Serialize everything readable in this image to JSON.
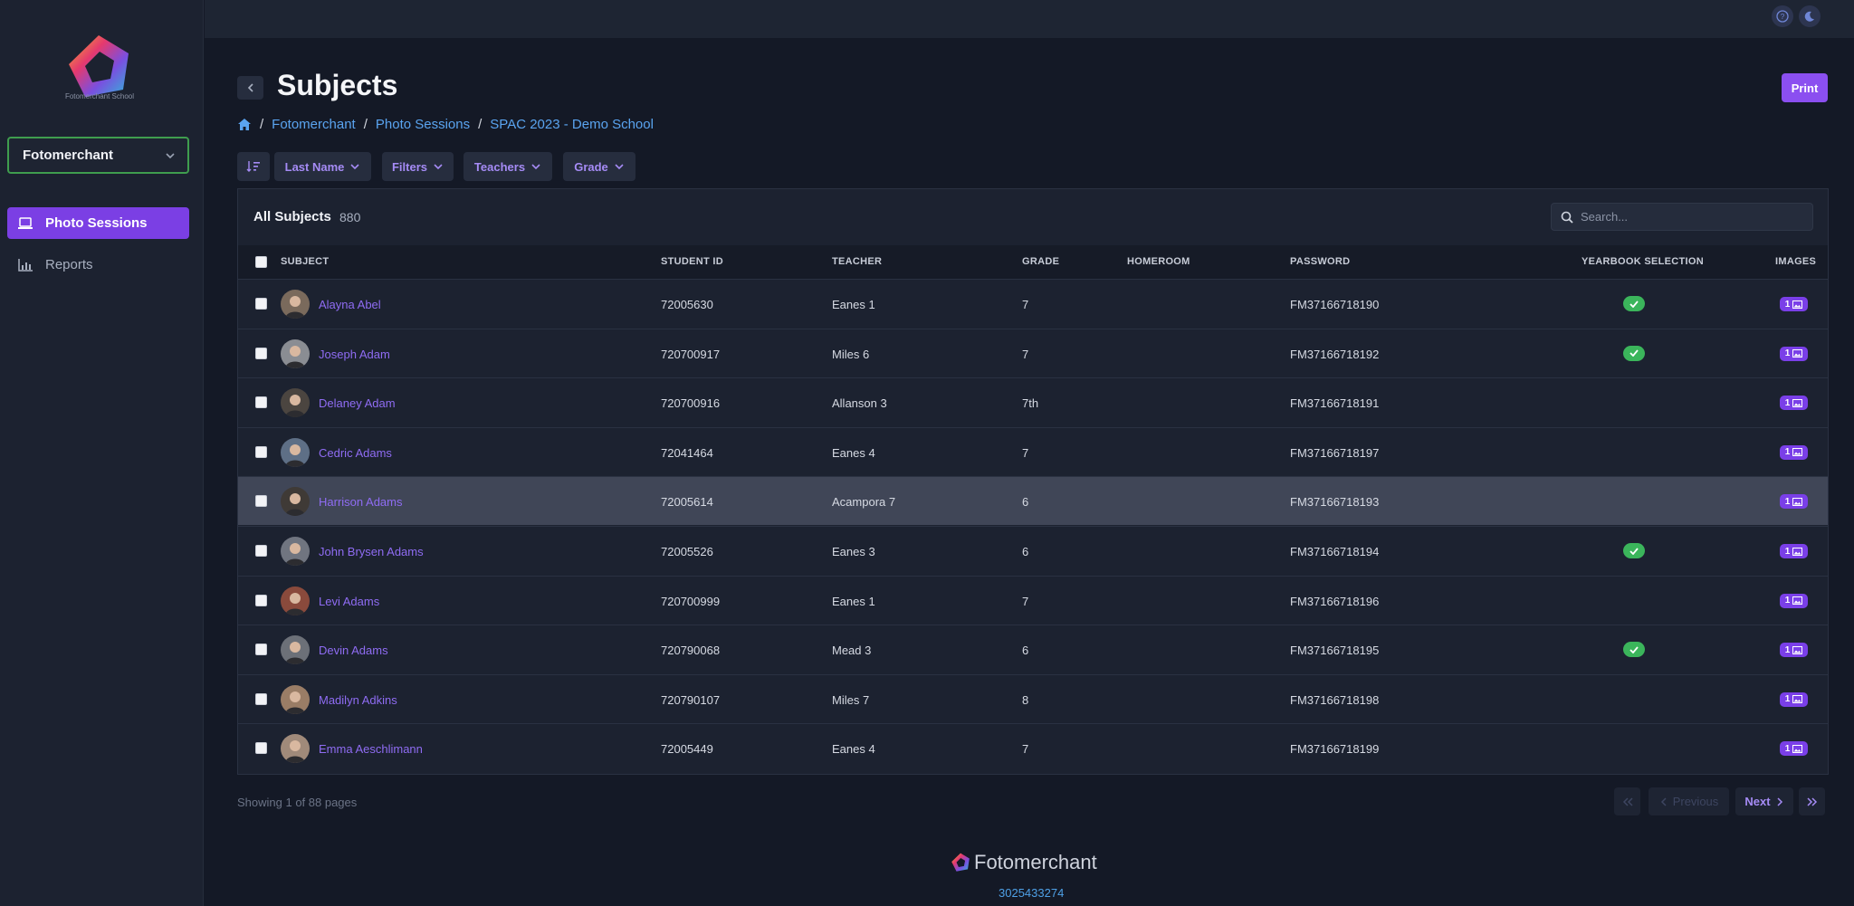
{
  "app": {
    "logo_text": "Fotomerchant School",
    "org_selector": "Fotomerchant",
    "nav": [
      {
        "label": "Photo Sessions",
        "icon": "laptop-icon",
        "active": true
      },
      {
        "label": "Reports",
        "icon": "bar-chart-icon",
        "active": false
      }
    ]
  },
  "header": {
    "title": "Subjects",
    "print_label": "Print",
    "breadcrumb": [
      "Fotomerchant",
      "Photo Sessions",
      "SPAC 2023 - Demo School"
    ]
  },
  "filters": {
    "sort_label": "Last Name",
    "filters_label": "Filters",
    "teachers_label": "Teachers",
    "grade_label": "Grade"
  },
  "table": {
    "title": "All Subjects",
    "count": "880",
    "search_placeholder": "Search...",
    "columns": {
      "subject": "SUBJECT",
      "student_id": "STUDENT ID",
      "teacher": "TEACHER",
      "grade": "GRADE",
      "homeroom": "HOMEROOM",
      "password": "PASSWORD",
      "yearbook": "YEARBOOK SELECTION",
      "images": "IMAGES"
    },
    "rows": [
      {
        "name": "Alayna Abel",
        "student_id": "72005630",
        "teacher": "Eanes 1",
        "grade": "7",
        "homeroom": "",
        "password": "FM37166718190",
        "yearbook": true,
        "images": "1"
      },
      {
        "name": "Joseph Adam",
        "student_id": "720700917",
        "teacher": "Miles 6",
        "grade": "7",
        "homeroom": "",
        "password": "FM37166718192",
        "yearbook": true,
        "images": "1"
      },
      {
        "name": "Delaney Adam",
        "student_id": "720700916",
        "teacher": "Allanson 3",
        "grade": "7th",
        "homeroom": "",
        "password": "FM37166718191",
        "yearbook": false,
        "images": "1"
      },
      {
        "name": "Cedric Adams",
        "student_id": "72041464",
        "teacher": "Eanes 4",
        "grade": "7",
        "homeroom": "",
        "password": "FM37166718197",
        "yearbook": false,
        "images": "1"
      },
      {
        "name": "Harrison Adams",
        "student_id": "72005614",
        "teacher": "Acampora 7",
        "grade": "6",
        "homeroom": "",
        "password": "FM37166718193",
        "yearbook": false,
        "images": "1",
        "hover": true
      },
      {
        "name": "John Brysen Adams",
        "student_id": "72005526",
        "teacher": "Eanes 3",
        "grade": "6",
        "homeroom": "",
        "password": "FM37166718194",
        "yearbook": true,
        "images": "1"
      },
      {
        "name": "Levi Adams",
        "student_id": "720700999",
        "teacher": "Eanes 1",
        "grade": "7",
        "homeroom": "",
        "password": "FM37166718196",
        "yearbook": false,
        "images": "1"
      },
      {
        "name": "Devin Adams",
        "student_id": "720790068",
        "teacher": "Mead 3",
        "grade": "6",
        "homeroom": "",
        "password": "FM37166718195",
        "yearbook": true,
        "images": "1"
      },
      {
        "name": "Madilyn Adkins",
        "student_id": "720790107",
        "teacher": "Miles 7",
        "grade": "8",
        "homeroom": "",
        "password": "FM37166718198",
        "yearbook": false,
        "images": "1"
      },
      {
        "name": "Emma Aeschlimann",
        "student_id": "72005449",
        "teacher": "Eanes 4",
        "grade": "7",
        "homeroom": "",
        "password": "FM37166718199",
        "yearbook": false,
        "images": "1"
      }
    ]
  },
  "pagination": {
    "showing": "Showing 1 of 88 pages",
    "previous": "Previous",
    "next": "Next"
  },
  "footer": {
    "brand": "Fotomerchant",
    "phone": "3025433274"
  },
  "colors": {
    "accent": "#7b3fe4",
    "link": "#5aa4f0",
    "success": "#3bb55b",
    "selector_border": "#3f9d4e"
  }
}
